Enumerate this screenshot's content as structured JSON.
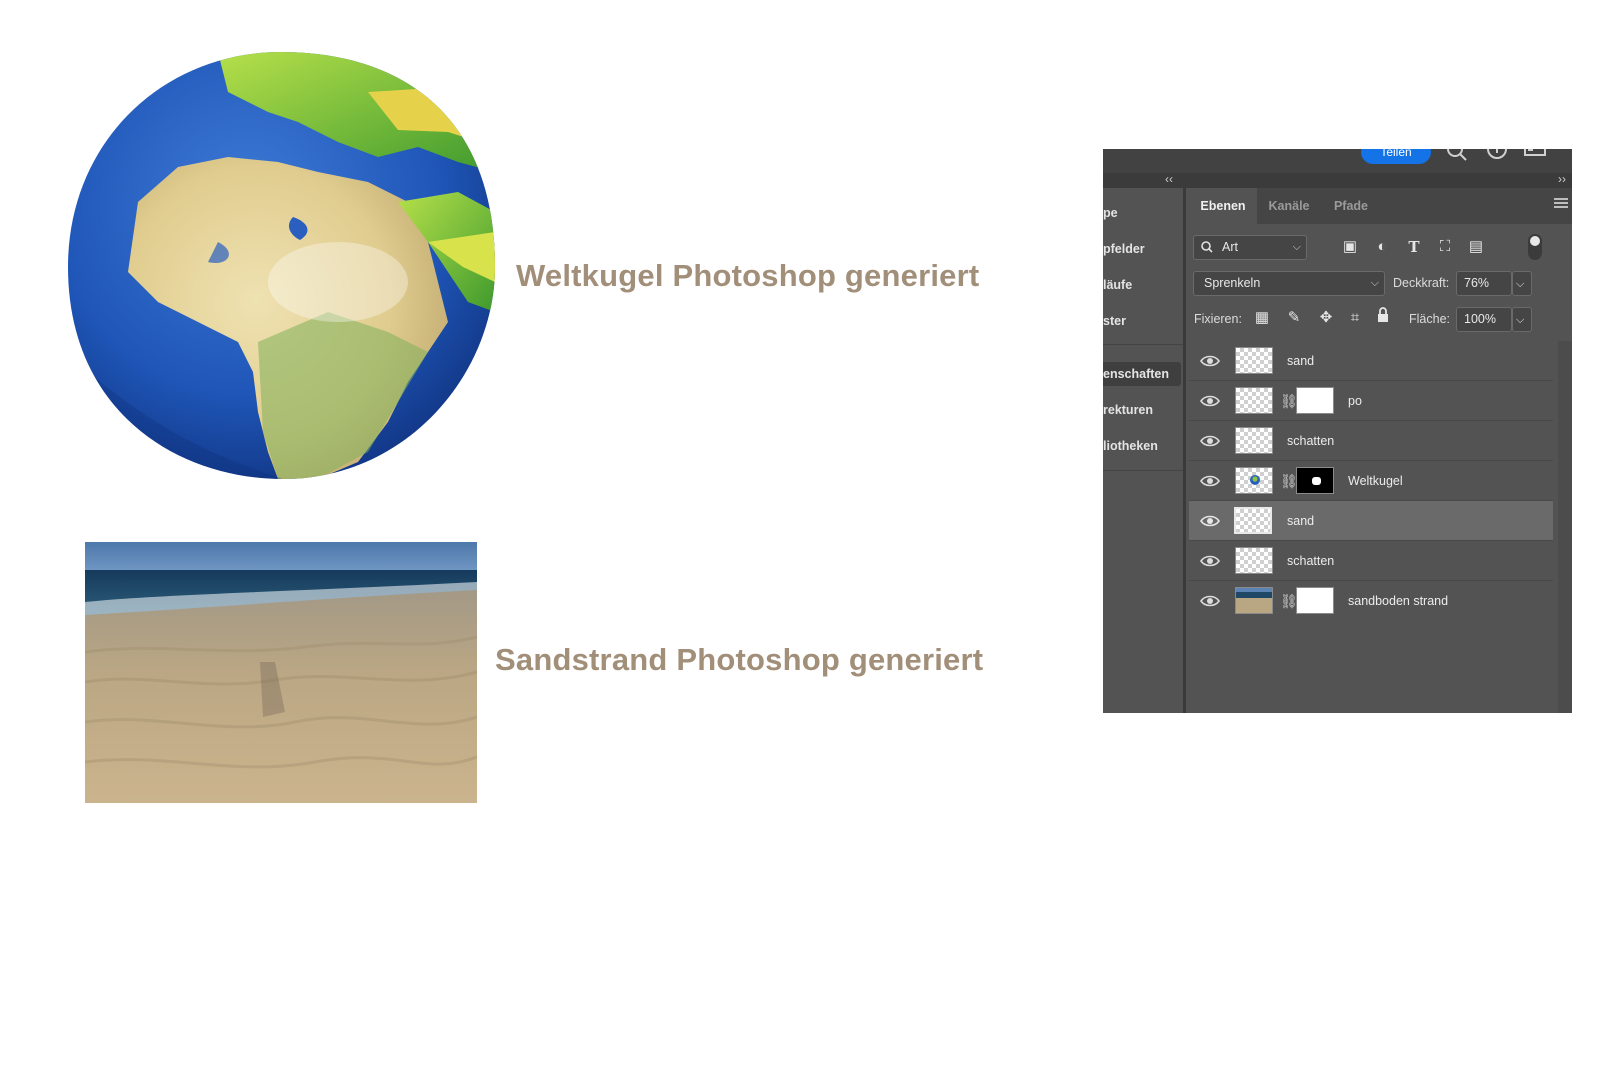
{
  "artwork": {
    "globe_caption": "Weltkugel Photoshop generiert",
    "sand_caption": "Sandstrand Photoshop generiert"
  },
  "photoshop": {
    "top_bar": {
      "share_label": "Teilen",
      "icons": [
        "search-icon",
        "help-icon",
        "panel-icon"
      ]
    },
    "left_dock": [
      {
        "label": "pe"
      },
      {
        "label": "pfelder"
      },
      {
        "label": "läufe"
      },
      {
        "label": "ster"
      },
      {
        "label": "enschaften",
        "active": true
      },
      {
        "label": "rekturen"
      },
      {
        "label": "liotheken"
      }
    ],
    "tabs": [
      {
        "label": "Ebenen",
        "active": true
      },
      {
        "label": "Kanäle"
      },
      {
        "label": "Pfade"
      }
    ],
    "filter": {
      "kind_label": "Art",
      "icons": [
        "image-filter-icon",
        "adjustment-filter-icon",
        "type-filter-icon",
        "shape-filter-icon",
        "smartobject-filter-icon"
      ]
    },
    "blend_mode": "Sprenkeln",
    "opacity_label": "Deckkraft:",
    "opacity_value": "76%",
    "lock_label": "Fixieren:",
    "fill_label": "Fläche:",
    "fill_value": "100%",
    "layers": [
      {
        "name": "sand",
        "thumb": "transparent",
        "mask": null,
        "visible": true,
        "selected": false
      },
      {
        "name": "po",
        "thumb": "transparent",
        "mask": "white",
        "visible": true,
        "selected": false
      },
      {
        "name": "schatten",
        "thumb": "transparent",
        "mask": null,
        "visible": true,
        "selected": false
      },
      {
        "name": "Weltkugel",
        "thumb": "globe",
        "mask": "black",
        "visible": true,
        "selected": false
      },
      {
        "name": "sand",
        "thumb": "transparent",
        "mask": null,
        "visible": true,
        "selected": true
      },
      {
        "name": "schatten",
        "thumb": "transparent",
        "mask": null,
        "visible": true,
        "selected": false
      },
      {
        "name": "sandboden strand",
        "thumb": "beach",
        "mask": "white",
        "visible": true,
        "selected": false
      }
    ],
    "colors": {
      "panel": "#535353",
      "selected_row": "#6a6a6a",
      "accent": "#1473e6",
      "caption": "#a28f79"
    }
  }
}
